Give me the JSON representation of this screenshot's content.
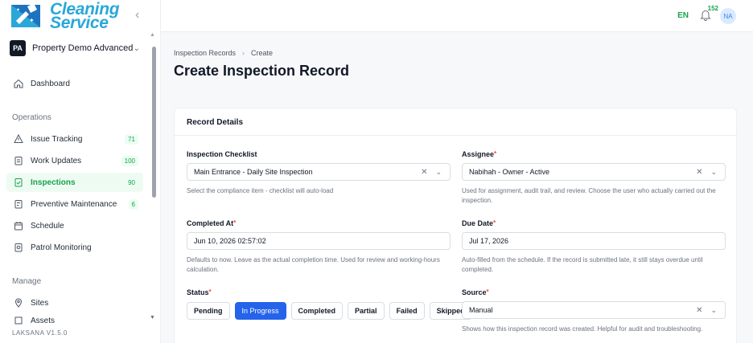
{
  "brand": {
    "line1": "Cleaning",
    "line2": "Service",
    "color": "#2aa7d8"
  },
  "property": {
    "initials": "PA",
    "name": "Property Demo Advanced"
  },
  "sidebar": {
    "dashboard": "Dashboard",
    "sections": {
      "operations": "Operations",
      "manage": "Manage"
    },
    "items": [
      {
        "label": "Issue Tracking",
        "badge": "71",
        "icon": "warning-triangle-icon"
      },
      {
        "label": "Work Updates",
        "badge": "100",
        "icon": "clipboard-icon"
      },
      {
        "label": "Inspections",
        "badge": "90",
        "icon": "checklist-icon"
      },
      {
        "label": "Preventive Maintenance",
        "badge": "6",
        "icon": "wrench-icon"
      },
      {
        "label": "Schedule",
        "badge": "",
        "icon": "calendar-icon"
      },
      {
        "label": "Patrol Monitoring",
        "badge": "",
        "icon": "patrol-icon"
      }
    ],
    "manage_items": [
      {
        "label": "Sites",
        "icon": "location-pin-icon"
      },
      {
        "label": "Assets",
        "icon": "box-icon"
      }
    ],
    "version": "LAKSANA V1.5.0"
  },
  "topbar": {
    "lang": "EN",
    "notif_count": "152",
    "user_initials": "NA"
  },
  "breadcrumb": {
    "parent": "Inspection Records",
    "current": "Create"
  },
  "page": {
    "title": "Create Inspection Record"
  },
  "form": {
    "card_title": "Record Details",
    "checklist": {
      "label": "Inspection Checklist",
      "value": "Main Entrance - Daily Site Inspection",
      "help": "Select the compliance item - checklist will auto-load"
    },
    "assignee": {
      "label": "Assignee",
      "value": "Nabihah - Owner - Active",
      "help": "Used for assignment, audit trail, and review. Choose the user who actually carried out the inspection."
    },
    "completed_at": {
      "label": "Completed At",
      "value": "Jun 10, 2026 02:57:02",
      "help": "Defaults to now. Leave as the actual completion time. Used for review and working-hours calculation."
    },
    "due_date": {
      "label": "Due Date",
      "value": "Jul 17, 2026",
      "help": "Auto-filled from the schedule. If the record is submitted late, it still stays overdue until completed."
    },
    "status": {
      "label": "Status",
      "options": [
        "Pending",
        "In Progress",
        "Completed",
        "Partial",
        "Failed",
        "Skipped"
      ],
      "selected": "In Progress"
    },
    "source": {
      "label": "Source",
      "value": "Manual",
      "help": "Shows how this inspection record was created. Helpful for audit and troubleshooting."
    }
  },
  "colors": {
    "accent_green": "#16a34a",
    "primary_blue": "#2563eb"
  }
}
